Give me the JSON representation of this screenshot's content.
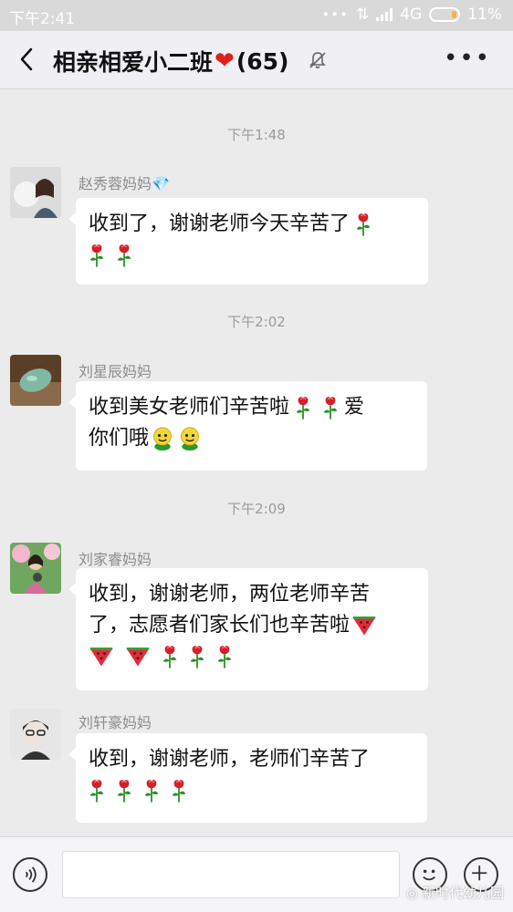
{
  "status_bar": {
    "time": "下午2:41",
    "network": "4G",
    "battery": "11%"
  },
  "header": {
    "title": "相亲相爱小二班",
    "count": "(65)"
  },
  "messages": [
    {
      "timestamp": "下午1:48",
      "sender": "赵秀蓉妈妈",
      "badge": "💎",
      "line1": "收到了，谢谢老师今天辛苦了",
      "emoji_line1": "rose",
      "emoji_line2": "rose rose"
    },
    {
      "timestamp": "下午2:02",
      "sender": "刘星辰妈妈",
      "line1": "收到美女老师们辛苦啦",
      "tail1": "爱",
      "line2": "你们哦"
    },
    {
      "timestamp": "下午2:09",
      "sender": "刘家睿妈妈",
      "line1": "收到，谢谢老师，两位老师辛苦",
      "line2": "了，志愿者们家长们也辛苦啦"
    },
    {
      "sender": "刘轩豪妈妈",
      "line1": "收到，谢谢老师，老师们辛苦了"
    }
  ],
  "bottom": {
    "watermark": "新时代幼儿园"
  },
  "icons": {
    "back": "back-arrow-icon",
    "mute": "mute-bell-icon",
    "more": "more-icon",
    "voice": "voice-icon",
    "emoji": "emoji-icon",
    "plus": "plus-icon",
    "rose": "rose-emoji",
    "melon": "watermelon-emoji",
    "smile": "green-smile-emoji"
  },
  "colors": {
    "heart": "#e0201b",
    "rose": "#d81e27",
    "leaf": "#2d8f2a"
  }
}
